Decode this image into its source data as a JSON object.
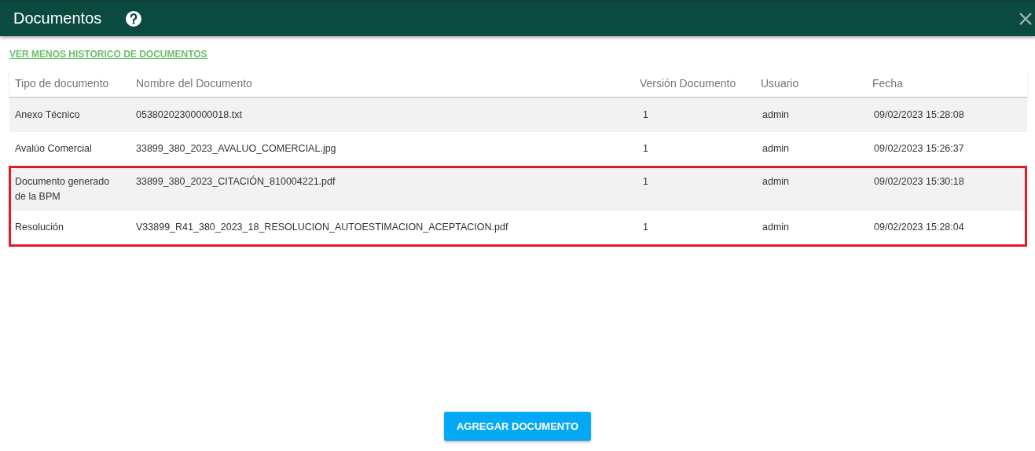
{
  "window": {
    "title": "Documentos"
  },
  "history_link": "VER MENOS HISTORICO DE DOCUMENTOS",
  "table": {
    "columns": [
      "Tipo de documento",
      "Nombre del Documento",
      "Versión Documento",
      "Usuario",
      "Fecha"
    ],
    "rows": [
      {
        "cells": [
          "Anexo Técnico",
          "05380202300000018.txt",
          "1",
          "admin",
          "09/02/2023 15:28:08"
        ],
        "highlighted": false
      },
      {
        "cells": [
          "Avalúo Comercial",
          "33899_380_2023_AVALUO_COMERCIAL.jpg",
          "1",
          "admin",
          "09/02/2023 15:26:37"
        ],
        "highlighted": false
      },
      {
        "cells": [
          "Documento generado de la BPM",
          "33899_380_2023_CITACIÓN_810004221.pdf",
          "1",
          "admin",
          "09/02/2023 15:30:18"
        ],
        "highlighted": true
      },
      {
        "cells": [
          "Resolución",
          "V33899_R41_380_2023_18_RESOLUCION_AUTOESTIMACION_ACEPTACION.pdf",
          "1",
          "admin",
          "09/02/2023 15:28:04"
        ],
        "highlighted": true
      }
    ]
  },
  "buttons": [
    "AGREGAR DOCUMENTO"
  ]
}
